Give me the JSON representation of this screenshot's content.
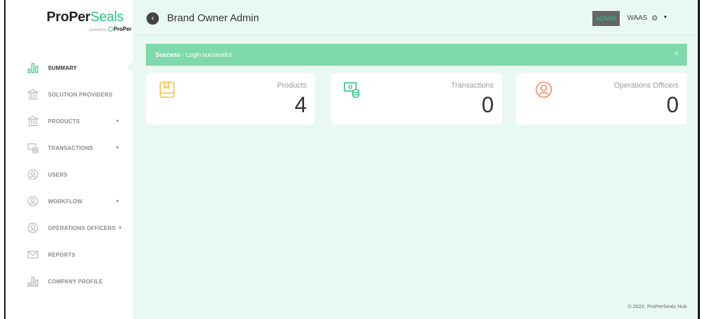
{
  "logo": {
    "brand_part1": "ProPer",
    "brand_part2": "Seals",
    "powered_by": "powered by",
    "sub_brand": "ProPer"
  },
  "sidebar": {
    "items": [
      {
        "label": "SUMMARY",
        "icon": "bar-chart-icon",
        "has_submenu": false,
        "active": true
      },
      {
        "label": "SOLUTION PROVIDERS",
        "icon": "bank-icon",
        "has_submenu": false
      },
      {
        "label": "PRODUCTS",
        "icon": "bank-icon",
        "has_submenu": true
      },
      {
        "label": "TRANSACTIONS",
        "icon": "money-icon",
        "has_submenu": true
      },
      {
        "label": "USERS",
        "icon": "user-circle-icon",
        "has_submenu": false
      },
      {
        "label": "WORKFLOW",
        "icon": "user-circle-icon",
        "has_submenu": true
      },
      {
        "label": "OPERATIONS OFFICERS",
        "icon": "user-circle-icon",
        "has_submenu": true
      },
      {
        "label": "REPORTS",
        "icon": "mail-icon",
        "has_submenu": false
      },
      {
        "label": "COMPANY PROFILE",
        "icon": "bar-chart-icon",
        "has_submenu": false
      }
    ]
  },
  "header": {
    "title": "Brand Owner Admin",
    "role_badge": "ADMIN",
    "workspace": "WAAS"
  },
  "alert": {
    "strong": "Success",
    "message": " - Login successful",
    "close": "×"
  },
  "cards": [
    {
      "label": "Products",
      "value": "4",
      "icon": "book-icon",
      "color": "#f5c242"
    },
    {
      "label": "Transactions",
      "value": "0",
      "icon": "money-stack-icon",
      "color": "#2fc47f"
    },
    {
      "label": "Operations Officers",
      "value": "0",
      "icon": "user-circle-icon",
      "color": "#f08a5d"
    }
  ],
  "footer": {
    "text": "© 2022, ProPerSeals Hub"
  },
  "colors": {
    "accent": "#2fc47f",
    "main_bg": "#e9f8f1",
    "alert_bg": "#80d9ab"
  }
}
